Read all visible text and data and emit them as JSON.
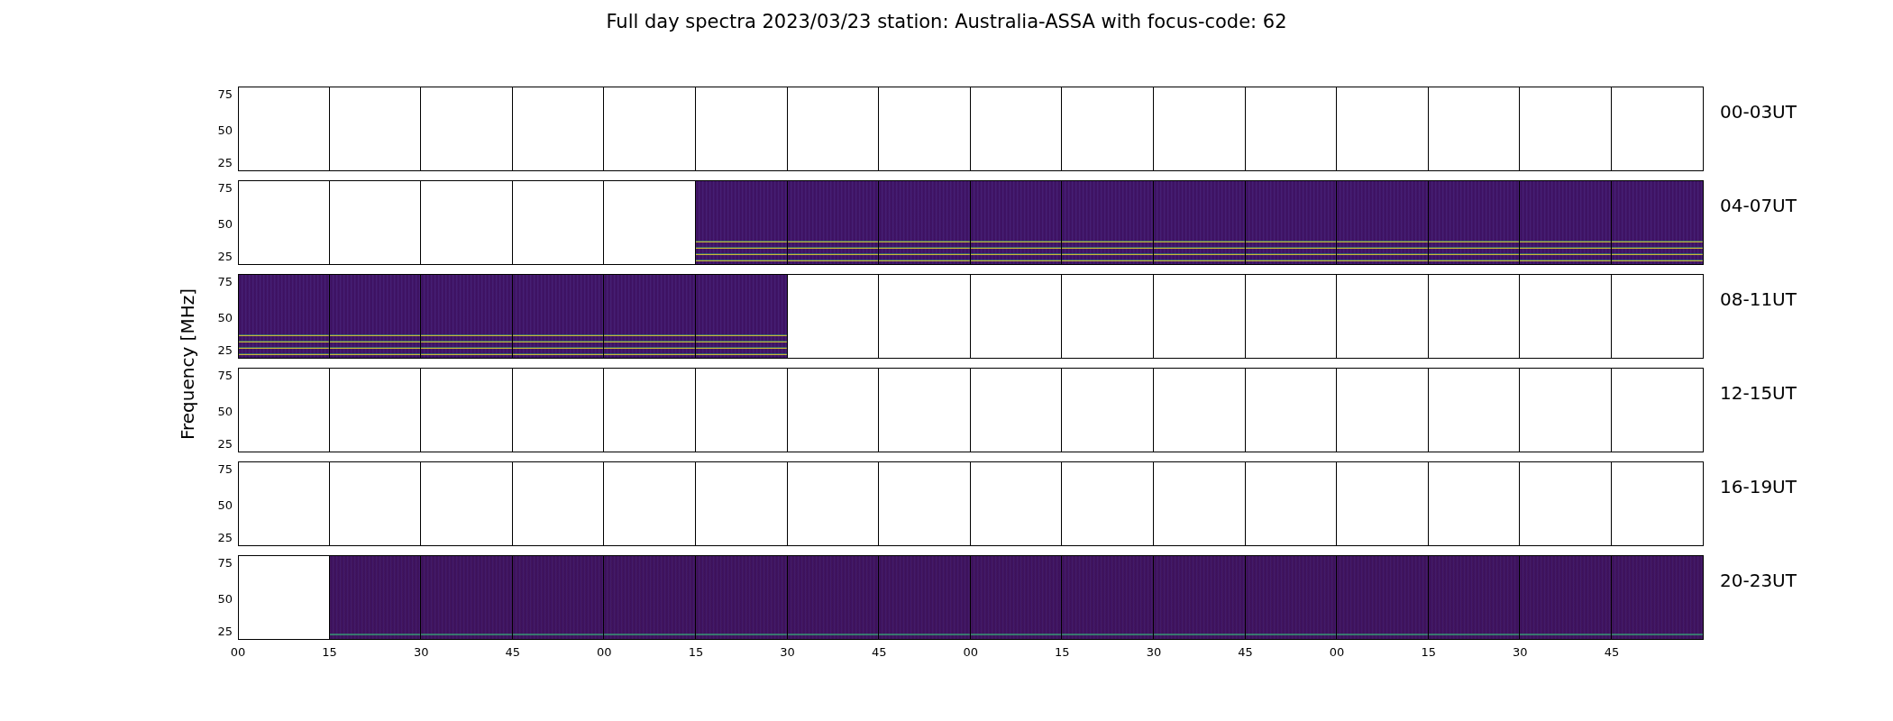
{
  "title": "Full day spectra 2023/03/23 station: Australia-ASSA with focus-code: 62",
  "ylabel": "Frequency [MHz]",
  "xticks": [
    "00",
    "15",
    "30",
    "45",
    "00",
    "15",
    "30",
    "45",
    "00",
    "15",
    "30",
    "45",
    "00",
    "15",
    "30",
    "45"
  ],
  "rows": [
    {
      "label": "00-03UT",
      "yticks": [
        "75",
        "50",
        "25"
      ],
      "panels": [
        {
          "has_data": false
        },
        {
          "has_data": false
        },
        {
          "has_data": false
        },
        {
          "has_data": false
        },
        {
          "has_data": false
        },
        {
          "has_data": false
        },
        {
          "has_data": false
        },
        {
          "has_data": false
        },
        {
          "has_data": false
        },
        {
          "has_data": false
        },
        {
          "has_data": false
        },
        {
          "has_data": false
        },
        {
          "has_data": false
        },
        {
          "has_data": false
        },
        {
          "has_data": false
        },
        {
          "has_data": false
        }
      ]
    },
    {
      "label": "04-07UT",
      "yticks": [
        "75",
        "50",
        "25"
      ],
      "panels": [
        {
          "has_data": false
        },
        {
          "has_data": false
        },
        {
          "has_data": false
        },
        {
          "has_data": false
        },
        {
          "has_data": false
        },
        {
          "has_data": true
        },
        {
          "has_data": true
        },
        {
          "has_data": true
        },
        {
          "has_data": true
        },
        {
          "has_data": true
        },
        {
          "has_data": true
        },
        {
          "has_data": true
        },
        {
          "has_data": true
        },
        {
          "has_data": true
        },
        {
          "has_data": true
        },
        {
          "has_data": true
        }
      ]
    },
    {
      "label": "08-11UT",
      "yticks": [
        "75",
        "50",
        "25"
      ],
      "panels": [
        {
          "has_data": true
        },
        {
          "has_data": true
        },
        {
          "has_data": true
        },
        {
          "has_data": true
        },
        {
          "has_data": true
        },
        {
          "has_data": true
        },
        {
          "has_data": false
        },
        {
          "has_data": false
        },
        {
          "has_data": false
        },
        {
          "has_data": false
        },
        {
          "has_data": false
        },
        {
          "has_data": false
        },
        {
          "has_data": false
        },
        {
          "has_data": false
        },
        {
          "has_data": false
        },
        {
          "has_data": false
        }
      ]
    },
    {
      "label": "12-15UT",
      "yticks": [
        "75",
        "50",
        "25"
      ],
      "panels": [
        {
          "has_data": false
        },
        {
          "has_data": false
        },
        {
          "has_data": false
        },
        {
          "has_data": false
        },
        {
          "has_data": false
        },
        {
          "has_data": false
        },
        {
          "has_data": false
        },
        {
          "has_data": false
        },
        {
          "has_data": false
        },
        {
          "has_data": false
        },
        {
          "has_data": false
        },
        {
          "has_data": false
        },
        {
          "has_data": false
        },
        {
          "has_data": false
        },
        {
          "has_data": false
        },
        {
          "has_data": false
        }
      ]
    },
    {
      "label": "16-19UT",
      "yticks": [
        "75",
        "50",
        "25"
      ],
      "panels": [
        {
          "has_data": false
        },
        {
          "has_data": false
        },
        {
          "has_data": false
        },
        {
          "has_data": false
        },
        {
          "has_data": false
        },
        {
          "has_data": false
        },
        {
          "has_data": false
        },
        {
          "has_data": false
        },
        {
          "has_data": false
        },
        {
          "has_data": false
        },
        {
          "has_data": false
        },
        {
          "has_data": false
        },
        {
          "has_data": false
        },
        {
          "has_data": false
        },
        {
          "has_data": false
        },
        {
          "has_data": false
        }
      ]
    },
    {
      "label": "20-23UT",
      "yticks": [
        "75",
        "50",
        "25"
      ],
      "panels": [
        {
          "has_data": false
        },
        {
          "has_data": true
        },
        {
          "has_data": true
        },
        {
          "has_data": true
        },
        {
          "has_data": true
        },
        {
          "has_data": true
        },
        {
          "has_data": true
        },
        {
          "has_data": true
        },
        {
          "has_data": true
        },
        {
          "has_data": true
        },
        {
          "has_data": true
        },
        {
          "has_data": true
        },
        {
          "has_data": true
        },
        {
          "has_data": true
        },
        {
          "has_data": true
        },
        {
          "has_data": true
        }
      ]
    }
  ]
}
